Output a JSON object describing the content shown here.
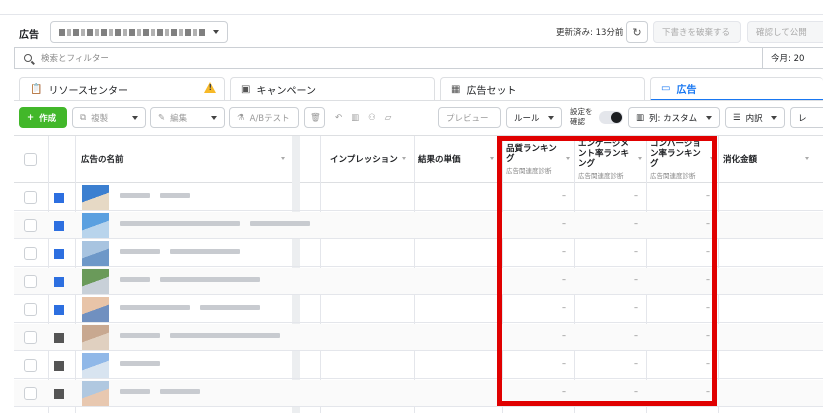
{
  "header": {
    "title": "広告",
    "updated_text": "更新済み: 13分前",
    "discard_label": "下書きを破棄する",
    "confirm_label": "確認して公開"
  },
  "search": {
    "placeholder": "検索とフィルター",
    "date_label": "今月: 20"
  },
  "tabs": [
    {
      "label": "リソースセンター",
      "icon": "clipboard-icon"
    },
    {
      "label": "キャンペーン",
      "icon": "folder-icon"
    },
    {
      "label": "広告セット",
      "icon": "grid-icon"
    },
    {
      "label": "広告",
      "icon": "ad-icon"
    }
  ],
  "toolbar": {
    "create_label": "作成",
    "duplicate_label": "複製",
    "edit_label": "編集",
    "ab_test_label": "A/Bテスト",
    "preview_label": "プレビュー",
    "rules_label": "ルール",
    "settings_confirm_label": "設定を\n確認",
    "columns_label": "列: カスタム",
    "breakdown_label": "内訳"
  },
  "table": {
    "columns": [
      {
        "label": "広告の名前",
        "sub": ""
      },
      {
        "label": "インプレッション",
        "sub": ""
      },
      {
        "label": "結果の単価",
        "sub": ""
      },
      {
        "label": "品質ランキング",
        "sub": "広告関連度診断"
      },
      {
        "label": "エンゲージメント率ランキング",
        "sub": "広告関連度診断"
      },
      {
        "label": "コンバージョン率ランキング",
        "sub": "広告関連度診断"
      },
      {
        "label": "消化金額",
        "sub": ""
      }
    ],
    "rows": [
      {
        "q": "–",
        "e": "–",
        "c": "–"
      },
      {
        "q": "–",
        "e": "–",
        "c": "–"
      },
      {
        "q": "–",
        "e": "–",
        "c": "–"
      },
      {
        "q": "–",
        "e": "–",
        "c": "–"
      },
      {
        "q": "–",
        "e": "–",
        "c": "–"
      },
      {
        "q": "–",
        "e": "–",
        "c": "–"
      },
      {
        "q": "–",
        "e": "–",
        "c": "–"
      },
      {
        "q": "–",
        "e": "–",
        "c": "–"
      }
    ]
  },
  "colors": {
    "accent": "#1877f2",
    "create": "#42b72a",
    "highlight": "#e00000",
    "warning": "#f7b928"
  }
}
